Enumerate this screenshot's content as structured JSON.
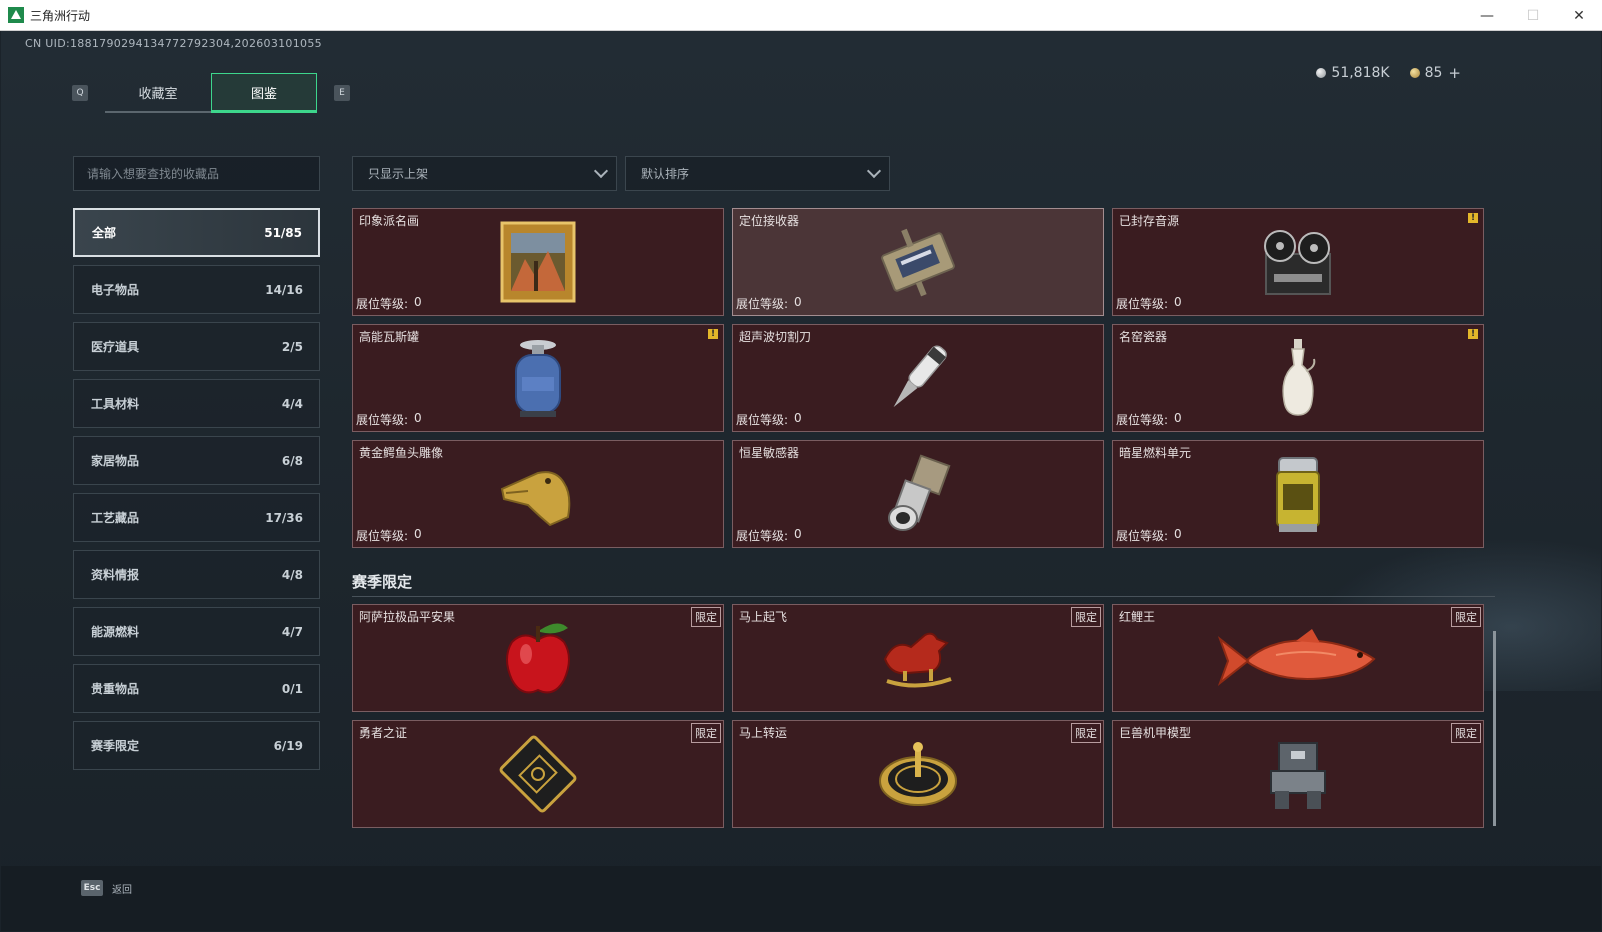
{
  "window": {
    "title": "三角洲行动"
  },
  "uid": "CN UID:1881790294134772792304,20260310105​5",
  "tabs": {
    "left_key": "Q",
    "right_key": "E",
    "items": [
      {
        "label": "收藏室",
        "active": false
      },
      {
        "label": "图鉴",
        "active": true
      }
    ]
  },
  "currency": {
    "silver": "51,818K",
    "gold": "85",
    "plus": "+"
  },
  "search": {
    "placeholder": "请输入想要查找的收藏品"
  },
  "categories": [
    {
      "label": "全部",
      "count": "51/85",
      "active": true
    },
    {
      "label": "电子物品",
      "count": "14/16"
    },
    {
      "label": "医疗道具",
      "count": "2/5"
    },
    {
      "label": "工具材料",
      "count": "4/4"
    },
    {
      "label": "家居物品",
      "count": "6/8"
    },
    {
      "label": "工艺藏品",
      "count": "17/36"
    },
    {
      "label": "资料情报",
      "count": "4/8"
    },
    {
      "label": "能源燃料",
      "count": "4/7"
    },
    {
      "label": "贵重物品",
      "count": "0/1"
    },
    {
      "label": "赛季限定",
      "count": "6/19"
    }
  ],
  "filters": {
    "shelf": "只显示上架",
    "sort": "默认排序"
  },
  "level_label": "展位等级:",
  "items": [
    {
      "name": "印象派名画",
      "level": "0",
      "icon": "painting"
    },
    {
      "name": "定位接收器",
      "level": "0",
      "icon": "receiver"
    },
    {
      "name": "已封存音源",
      "level": "0",
      "icon": "tape-recorder"
    },
    {
      "name": "高能瓦斯罐",
      "level": "0",
      "icon": "gas-tank"
    },
    {
      "name": "超声波切割刀",
      "level": "0",
      "icon": "cutter"
    },
    {
      "name": "名窑瓷器",
      "level": "0",
      "icon": "vase"
    },
    {
      "name": "黄金鳄鱼头雕像",
      "level": "0",
      "icon": "crocodile"
    },
    {
      "name": "恒星敏感器",
      "level": "0",
      "icon": "star-sensor"
    },
    {
      "name": "暗星燃料单元",
      "level": "0",
      "icon": "fuel-cell"
    }
  ],
  "warn_mark": "!",
  "season": {
    "title": "赛季限定",
    "badge": "限定",
    "items": [
      {
        "name": "阿萨拉极品平安果",
        "icon": "apple"
      },
      {
        "name": "马上起飞",
        "icon": "horse"
      },
      {
        "name": "红鲤王",
        "icon": "carp"
      },
      {
        "name": "勇者之证",
        "icon": "card"
      },
      {
        "name": "马上转运",
        "icon": "wheel"
      },
      {
        "name": "巨兽机甲模型",
        "icon": "mech"
      }
    ]
  },
  "footer": {
    "key": "Esc",
    "label": "返回"
  }
}
